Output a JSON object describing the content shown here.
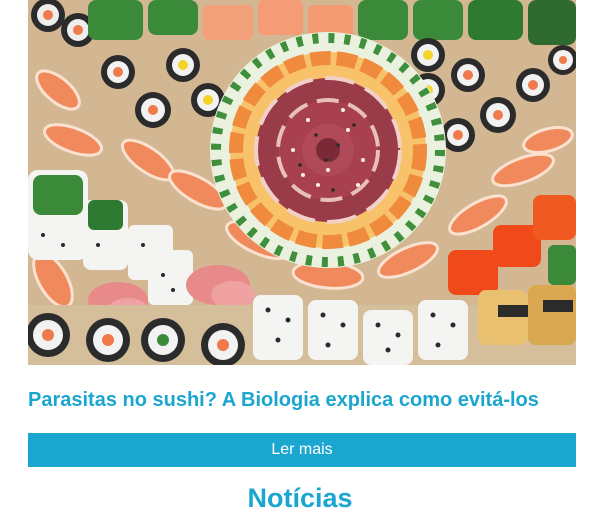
{
  "article": {
    "image_icon": "sushi-platter-photo",
    "title": "Parasitas no sushi? A Biologia explica como evitá-los",
    "read_more_label": "Ler mais"
  },
  "section": {
    "heading": "Notícias"
  },
  "colors": {
    "accent": "#1ba6cf",
    "button_text": "#ffffff",
    "background": "#ffffff"
  }
}
